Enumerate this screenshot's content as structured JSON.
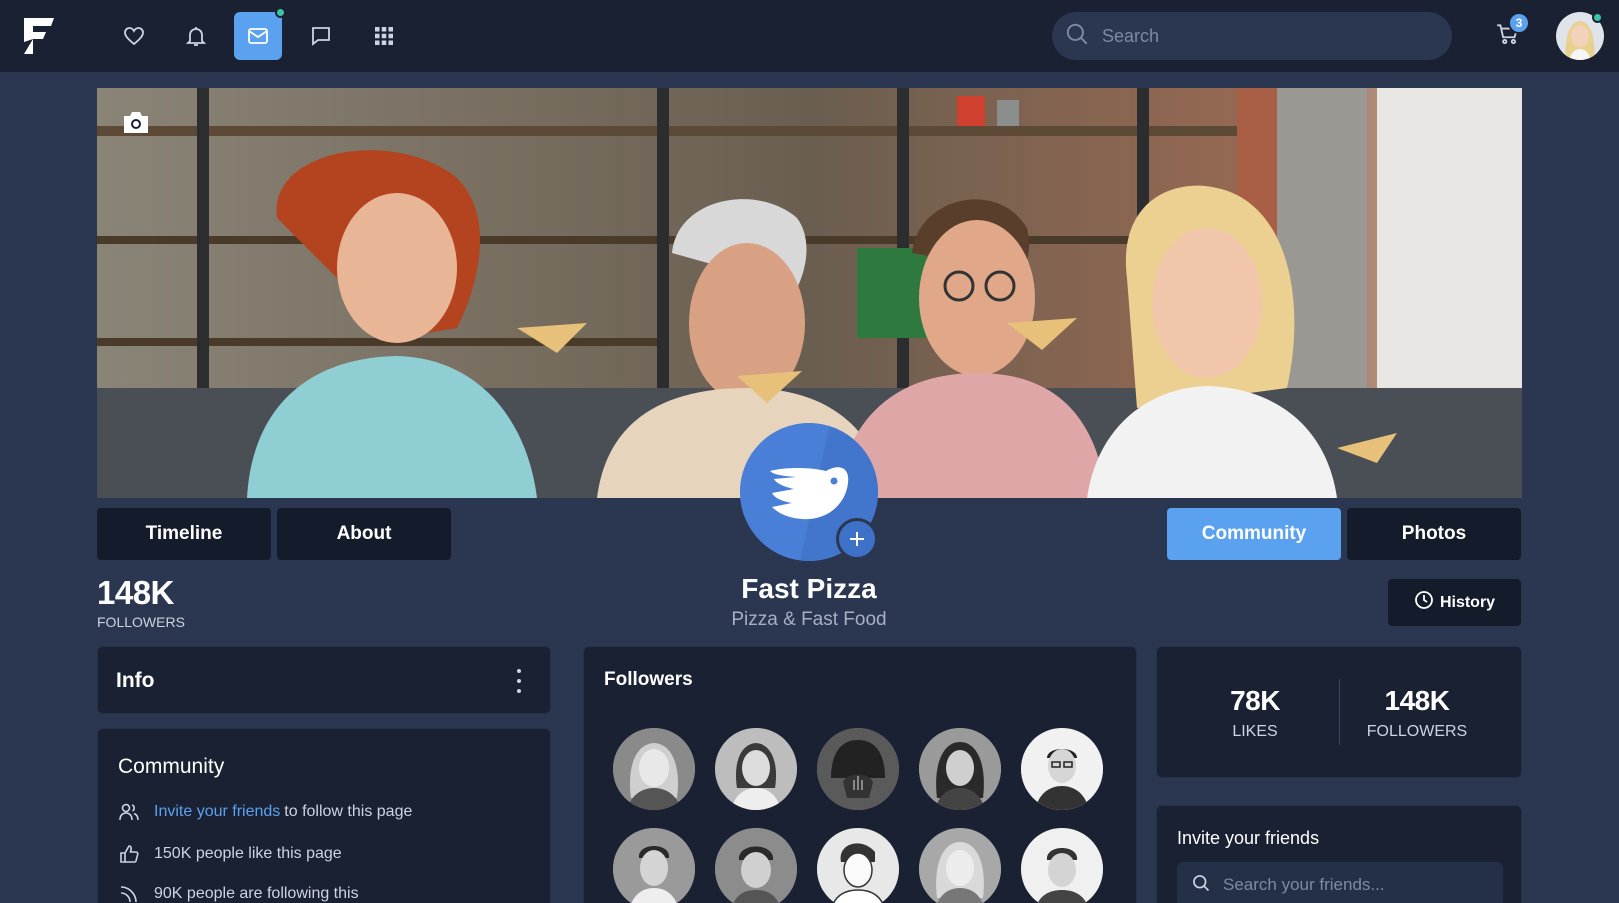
{
  "nav": {
    "search_placeholder": "Search",
    "cart_count": "3"
  },
  "tabs": {
    "timeline": "Timeline",
    "about": "About",
    "community": "Community",
    "photos": "Photos"
  },
  "page": {
    "name": "Fast Pizza",
    "category": "Pizza & Fast Food",
    "followers_count": "148K",
    "followers_label": "FOLLOWERS",
    "history_label": "History"
  },
  "info": {
    "title": "Info"
  },
  "community": {
    "title": "Community",
    "invite_link": "Invite your friends",
    "invite_rest": "to follow this page",
    "likes_text": "150K people like this page",
    "following_text": "90K people are following this"
  },
  "followers": {
    "title": "Followers"
  },
  "stats": {
    "likes_num": "78K",
    "likes_label": "LIKES",
    "followers_num": "148K",
    "followers_label": "FOLLOWERS"
  },
  "invite": {
    "title": "Invite your friends",
    "placeholder": "Search your friends..."
  },
  "colors": {
    "accent": "#5aa2f0",
    "online": "#38c7a6",
    "background": "#2b3650",
    "card": "#1a2133"
  }
}
